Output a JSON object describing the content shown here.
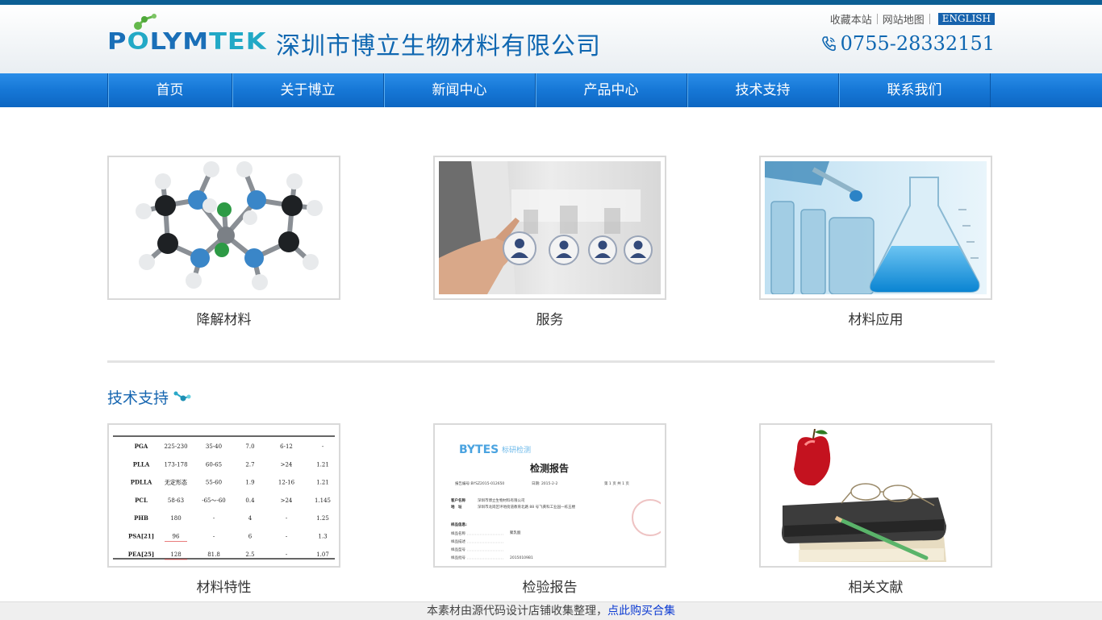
{
  "brand": {
    "logo_text": "POLYMTEK",
    "company_name": "深圳市博立生物材料有限公司",
    "colors": {
      "primary": "#0f67b1",
      "accent": "#22a9c6",
      "nav": "#1677d6"
    }
  },
  "toplinks": {
    "favorite": "收藏本站",
    "sitemap": "网站地图",
    "english": "ENGLISH"
  },
  "phone": {
    "icon": "phone-icon",
    "number": "0755-28332151"
  },
  "nav": {
    "items": [
      {
        "label": "首页"
      },
      {
        "label": "关于博立"
      },
      {
        "label": "新闻中心"
      },
      {
        "label": "产品中心"
      },
      {
        "label": "技术支持"
      },
      {
        "label": "联系我们"
      }
    ]
  },
  "features": [
    {
      "caption": "降解材料",
      "image": "molecule-model-image"
    },
    {
      "caption": "服务",
      "image": "service-touch-image"
    },
    {
      "caption": "材料应用",
      "image": "lab-glassware-image"
    }
  ],
  "tech_support": {
    "title": "技术支持",
    "icon": "molecule-icon",
    "cards": [
      {
        "caption": "材料特性",
        "image": "property-table-image"
      },
      {
        "caption": "检验报告",
        "image": "test-report-image"
      },
      {
        "caption": "相关文献",
        "image": "apple-books-image"
      }
    ],
    "table": {
      "rows": [
        [
          "PGA",
          "225-230",
          "35-40",
          "7.0",
          "6-12",
          "-"
        ],
        [
          "PLLA",
          "173-178",
          "60-65",
          "2.7",
          ">24",
          "1.21"
        ],
        [
          "PDLLA",
          "无定形态",
          "55-60",
          "1.9",
          "12-16",
          "1.21"
        ],
        [
          "PCL",
          "58-63",
          "-65～-60",
          "0.4",
          ">24",
          "1.145"
        ],
        [
          "PHB",
          "180",
          "-",
          "4",
          "-",
          "1.25"
        ],
        [
          "PSA[21]",
          "96",
          "-",
          "6",
          "-",
          "1.3"
        ],
        [
          "PEA[25]",
          "128",
          "81.8",
          "2.5",
          "-",
          "1.07"
        ]
      ]
    },
    "report": {
      "brand": "BYTES",
      "brand_cn": "标研检测",
      "title": "检测报告",
      "number": "报告编号:BYSZ2015-012650",
      "date": "日期: 2015-2-2",
      "page": "第 1 页 共 1 页",
      "client_label": "客户名称",
      "client": "深圳市博立生物材料有限公司",
      "address_label": "地　址",
      "address": "深圳市龙岗区坪地街道教育北路 88 号飞黄科工业园一栋五楼",
      "sample_info": "样品信息:",
      "sample_name_label": "样品名称",
      "sample_name": "聚乳酸",
      "sample_desc_label": "样品描述",
      "sample_model_label": "样品型号",
      "sample_no_label": "样品批号",
      "sample_no": "20150109B1"
    }
  },
  "footer": {
    "text": "本素材由源代码设计店铺收集整理，",
    "link": "点此购买合集"
  }
}
